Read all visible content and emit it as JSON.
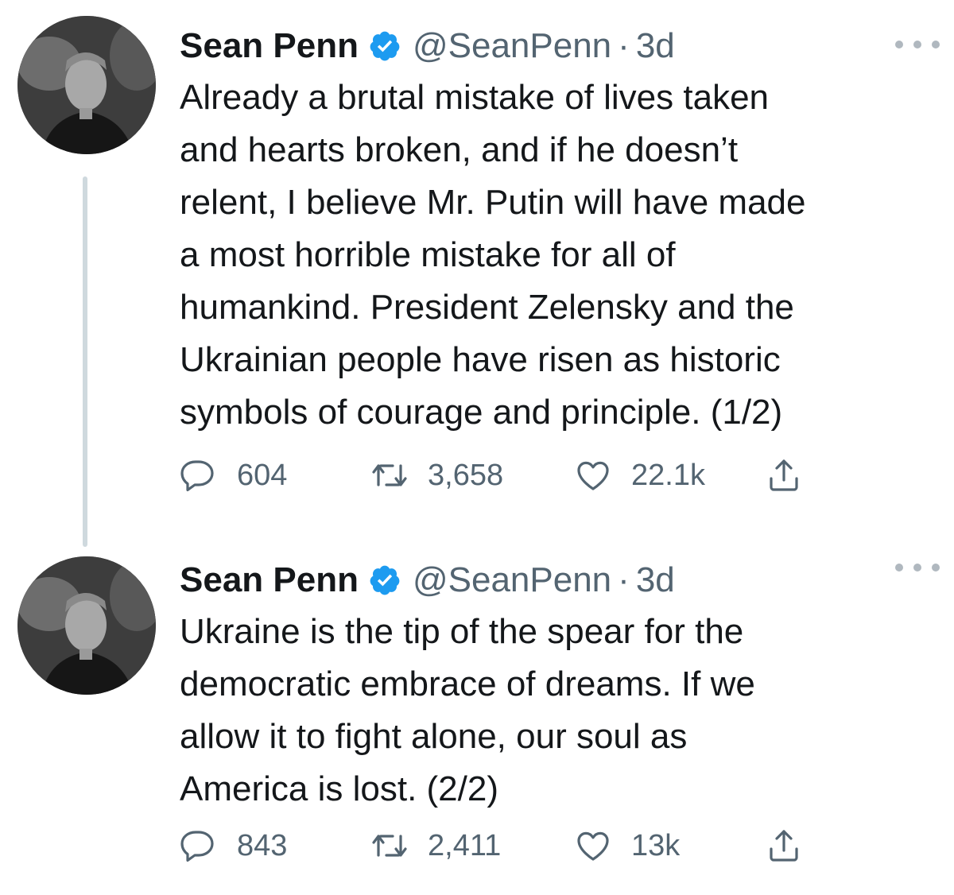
{
  "tweets": [
    {
      "name": "Sean Penn",
      "handle": "@SeanPenn",
      "separator": "·",
      "time": "3d",
      "lines": [
        "Already a brutal mistake of lives taken",
        "and hearts broken, and if he doesn’t",
        "relent, I believe Mr. Putin will have made",
        "a most horrible mistake for all of",
        "humankind. President Zelensky and the",
        "Ukrainian people have risen as historic",
        "symbols of courage and principle. (1/2)"
      ],
      "replies": "604",
      "retweets": "3,658",
      "likes": "22.1k"
    },
    {
      "name": "Sean Penn",
      "handle": "@SeanPenn",
      "separator": "·",
      "time": "3d",
      "lines": [
        "Ukraine is the tip of the spear for the",
        "democratic embrace of dreams. If we",
        "allow it to fight alone, our soul as",
        "America is lost. (2/2)"
      ],
      "replies": "843",
      "retweets": "2,411",
      "likes": "13k"
    }
  ],
  "icons": {
    "verified": "verified-badge-icon",
    "more": "more-options-icon",
    "reply": "reply-icon",
    "retweet": "retweet-icon",
    "like": "like-icon",
    "share": "share-icon"
  },
  "colors": {
    "verified": "#1d9bf0",
    "secondary_text": "#536471",
    "thread_line": "#cfd9de"
  }
}
